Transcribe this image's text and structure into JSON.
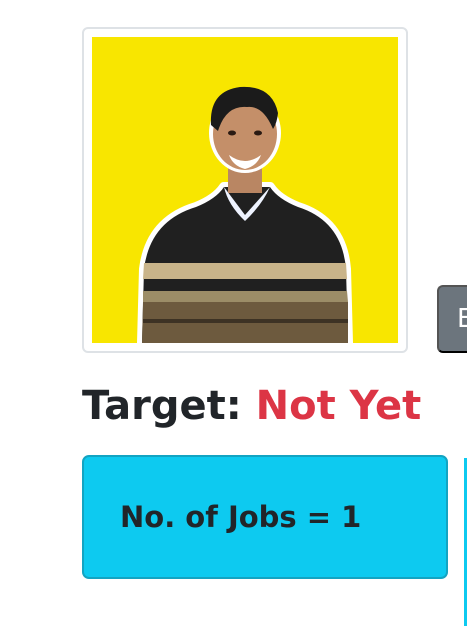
{
  "profile": {
    "photo_bg": "#f8e600"
  },
  "target": {
    "label": "Target: ",
    "status": "Not Yet",
    "status_color": "#dc3545"
  },
  "jobs_card": {
    "text": "No. of Jobs = 1",
    "bg_color": "#0dcaf0"
  },
  "side_button": {
    "label": "E"
  }
}
